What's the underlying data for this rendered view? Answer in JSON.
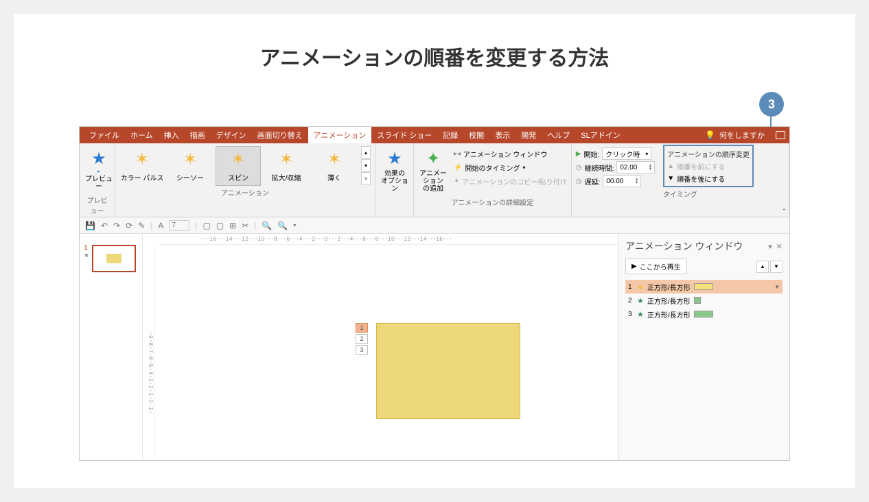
{
  "page_title": "アニメーションの順番を変更する方法",
  "callout_number": "3",
  "tabs": [
    "ファイル",
    "ホーム",
    "挿入",
    "描画",
    "デザイン",
    "画面切り替え",
    "アニメーション",
    "スライド ショー",
    "記録",
    "校閲",
    "表示",
    "開発",
    "ヘルプ",
    "SLアドイン"
  ],
  "active_tab_index": 6,
  "tell_me": "何をしますか",
  "ribbon": {
    "preview": {
      "label": "プレビュー",
      "group": "プレビュー"
    },
    "anim_items": [
      {
        "label": "カラー パルス",
        "color": "#f4b942"
      },
      {
        "label": "シーソー",
        "color": "#f4b942"
      },
      {
        "label": "スピン",
        "color": "#f4b942",
        "selected": true
      },
      {
        "label": "拡大/収縮",
        "color": "#f4b942"
      },
      {
        "label": "薄く",
        "color": "#f4b942"
      }
    ],
    "anim_group": "アニメーション",
    "effect_options": "効果の\nオプション",
    "add_anim": "アニメーション\nの追加",
    "anim_pane_btn": "アニメーション ウィンドウ",
    "trigger": "開始のタイミング",
    "painter": "アニメーションのコピー/貼り付け",
    "detail_group": "アニメーションの詳細設定",
    "start_label": "開始:",
    "start_value": "クリック時",
    "duration_label": "継続時間:",
    "duration_value": "02.00",
    "delay_label": "遅延:",
    "delay_value": "00.00",
    "timing_group": "タイミング",
    "reorder_title": "アニメーションの順序変更",
    "move_earlier": "順番を前にする",
    "move_later": "順番を後にする"
  },
  "qat_font_size": "7",
  "ruler_h_text": "･･･16･･･14･･･12･･･10･･･8･･･6･･･4･･･2･･･0･･･2･･･4･･･6･･･8･･･10･･･12･･･14･･･16･･･",
  "ruler_v_text": "･9･8･7･6･5･4･3･2･1･0･1･",
  "slide_tags": [
    "1",
    "2",
    "3"
  ],
  "thumb": {
    "number": "1"
  },
  "anim_pane": {
    "title": "アニメーション ウィンドウ",
    "play": "ここから再生",
    "rows": [
      {
        "n": "1",
        "name": "正方形/長方形",
        "bar": "y",
        "sel": true,
        "star": "#f4b942"
      },
      {
        "n": "2",
        "name": "正方形/長方形",
        "bar": "g1",
        "sel": false,
        "star": "#2e8b57"
      },
      {
        "n": "3",
        "name": "正方形/長方形",
        "bar": "g2",
        "sel": false,
        "star": "#2e8b57"
      }
    ]
  }
}
